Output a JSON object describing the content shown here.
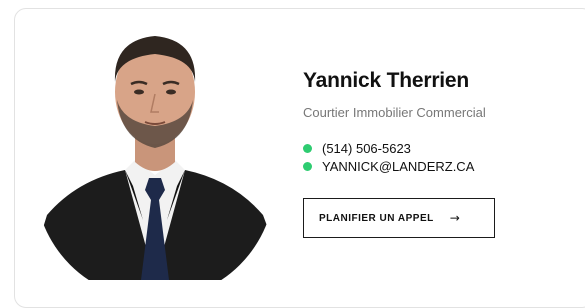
{
  "profile": {
    "name": "Yannick Therrien",
    "role": "Courtier Immobilier Commercial",
    "photo_alt": "portrait-photo"
  },
  "contacts": [
    {
      "text": "(514) 506-5623",
      "icon": "green-dot-icon"
    },
    {
      "text": "YANNICK@LANDERZ.CA",
      "icon": "green-dot-icon"
    }
  ],
  "cta": {
    "label": "PLANIFIER UN APPEL",
    "arrow": "→",
    "icon": "arrow-right-icon"
  },
  "colors": {
    "accent_dot": "#2ecc71",
    "text": "#111111",
    "muted": "#777777",
    "border": "#e2e2e2"
  }
}
